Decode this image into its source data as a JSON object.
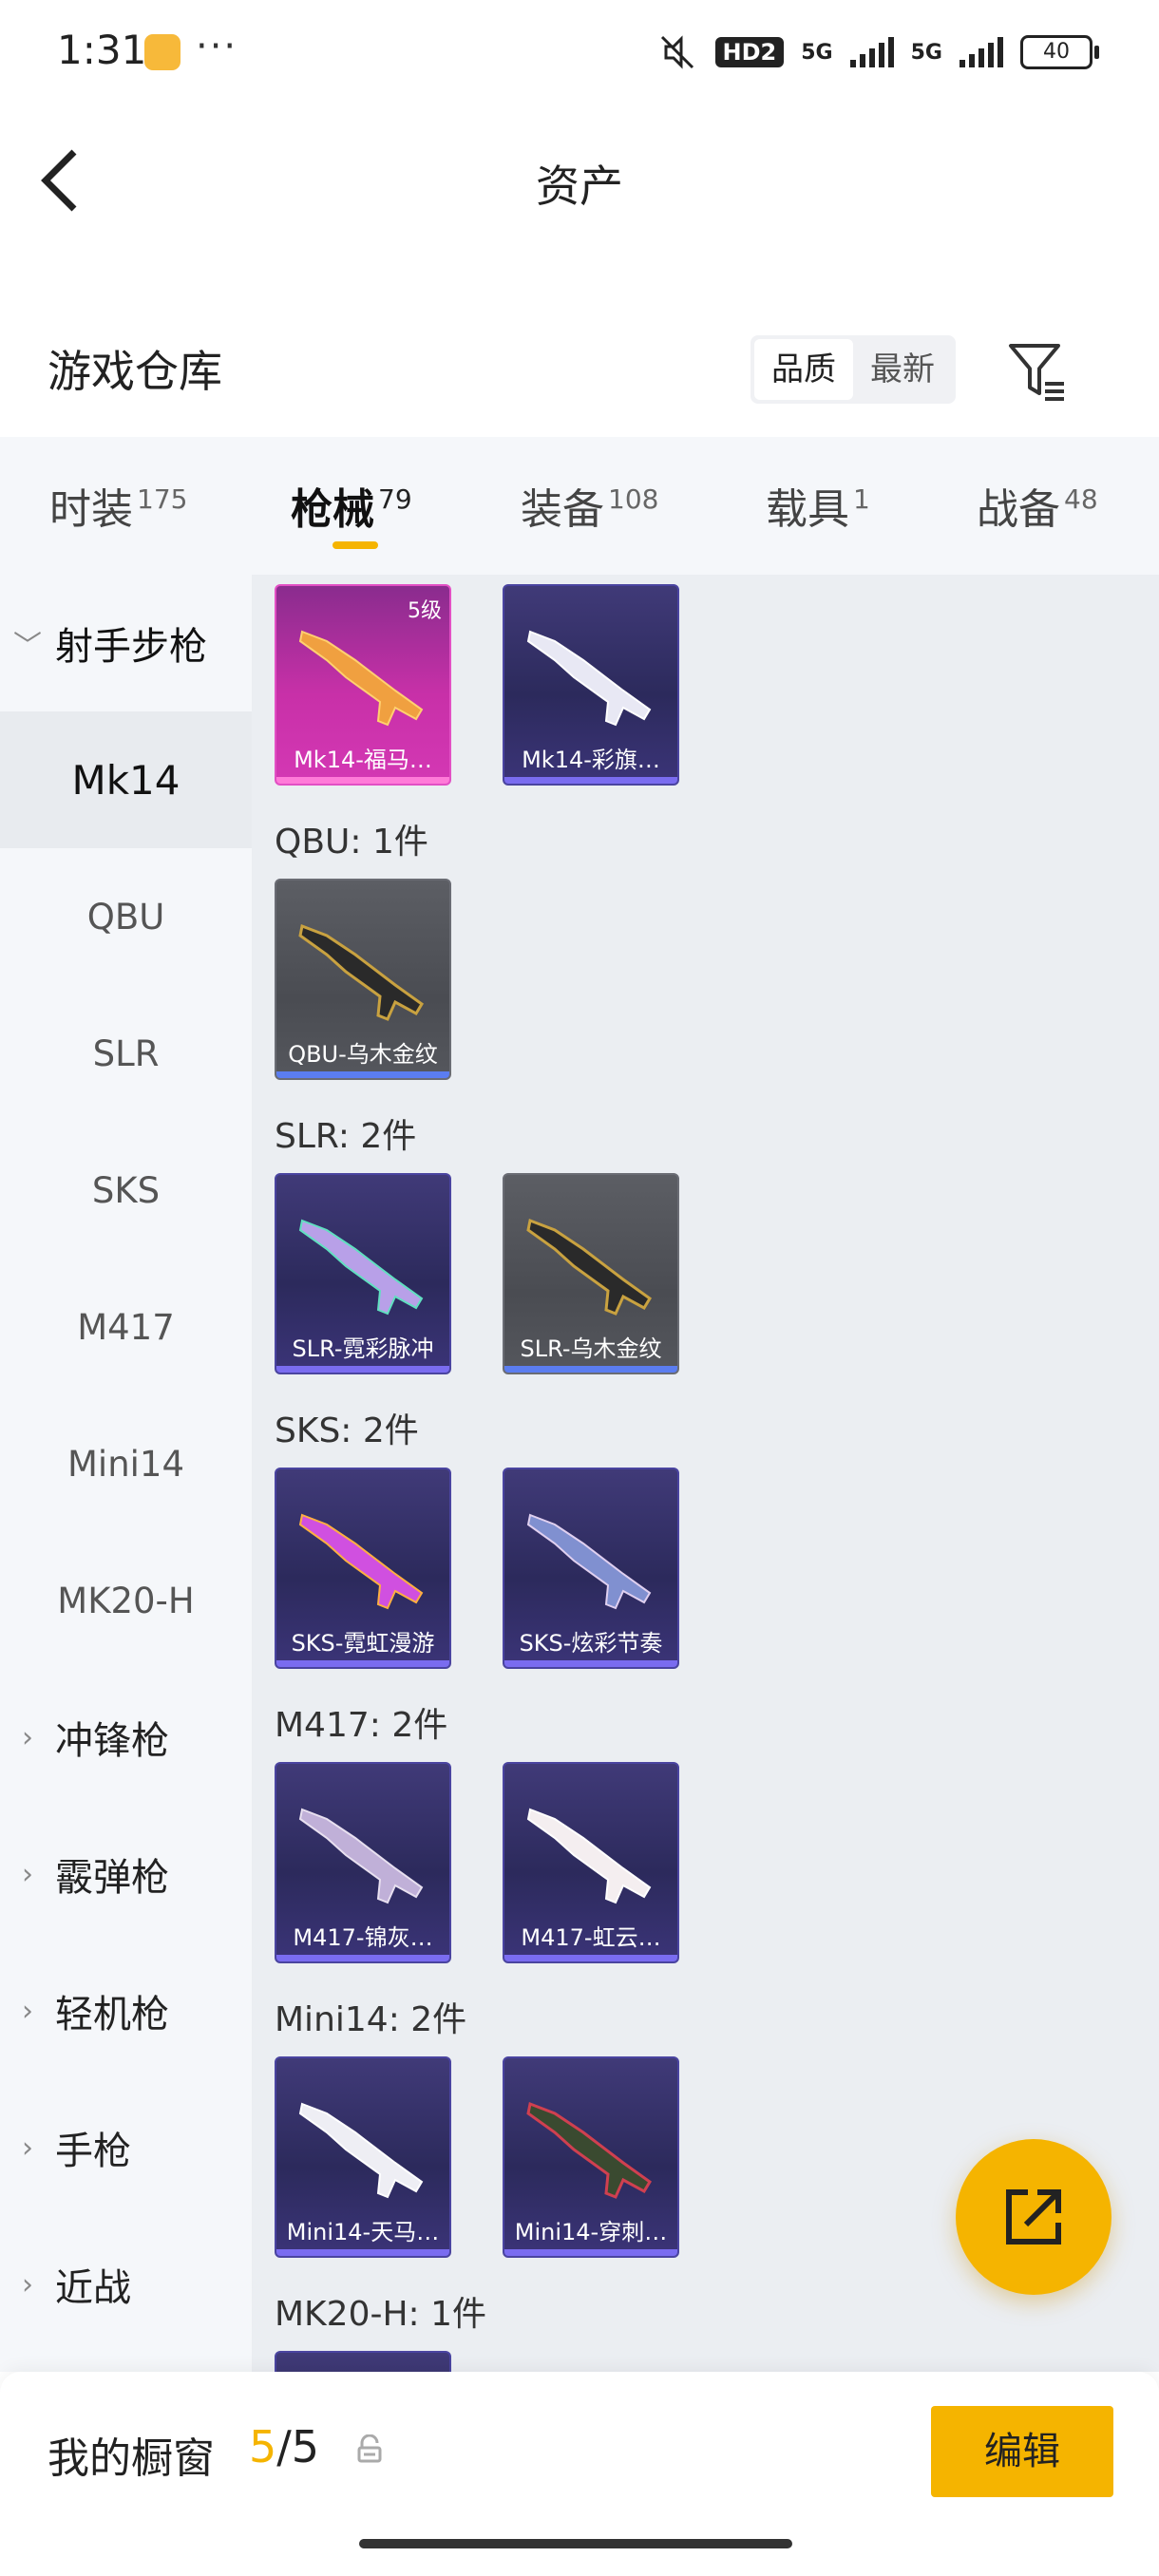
{
  "status_bar": {
    "time": "1:31",
    "dots": "···",
    "hd": "HD2",
    "net1": "5G",
    "net2": "5G",
    "battery": "40"
  },
  "header": {
    "title": "资产"
  },
  "warehouse": {
    "title": "游戏仓库",
    "sort_options": [
      "品质",
      "最新"
    ],
    "sort_active": "品质"
  },
  "tabs": [
    {
      "label": "时装",
      "count": "175"
    },
    {
      "label": "枪械",
      "count": "79"
    },
    {
      "label": "装备",
      "count": "108"
    },
    {
      "label": "载具",
      "count": "1"
    },
    {
      "label": "战备",
      "count": "48"
    }
  ],
  "active_tab": "枪械",
  "sidebar": {
    "group_expanded": "射手步枪",
    "sub_items": [
      "Mk14",
      "QBU",
      "SLR",
      "SKS",
      "M417",
      "Mini14",
      "MK20-H"
    ],
    "selected_sub": "Mk14",
    "groups": [
      "冲锋枪",
      "霰弹枪",
      "轻机枪",
      "手枪",
      "近战"
    ]
  },
  "content": {
    "sections": [
      {
        "label": "",
        "items": [
          {
            "name": "Mk14-福马…",
            "rarity": "pink",
            "level": "5级"
          },
          {
            "name": "Mk14-彩旗…",
            "rarity": "purple"
          }
        ]
      },
      {
        "label": "QBU: 1件",
        "items": [
          {
            "name": "QBU-乌木金纹",
            "rarity": "grey"
          }
        ]
      },
      {
        "label": "SLR: 2件",
        "items": [
          {
            "name": "SLR-霓彩脉冲",
            "rarity": "purple"
          },
          {
            "name": "SLR-乌木金纹",
            "rarity": "grey"
          }
        ]
      },
      {
        "label": "SKS: 2件",
        "items": [
          {
            "name": "SKS-霓虹漫游",
            "rarity": "purple"
          },
          {
            "name": "SKS-炫彩节奏",
            "rarity": "purple"
          }
        ]
      },
      {
        "label": "M417: 2件",
        "items": [
          {
            "name": "M417-锦灰…",
            "rarity": "purple"
          },
          {
            "name": "M417-虹云…",
            "rarity": "purple"
          }
        ]
      },
      {
        "label": "Mini14: 2件",
        "items": [
          {
            "name": "Mini14-天马…",
            "rarity": "purple"
          },
          {
            "name": "Mini14-穿刺…",
            "rarity": "purple"
          }
        ]
      },
      {
        "label": "MK20-H: 1件",
        "items": []
      }
    ]
  },
  "bottom": {
    "title": "我的橱窗",
    "count_current": "5",
    "count_sep": "/",
    "count_total": "5",
    "edit_label": "编辑"
  },
  "colors": {
    "accent": "#f5b400",
    "purple_card": "#2c2a5c",
    "pink_card": "#c830a8",
    "grey_card": "#4a4c52"
  }
}
